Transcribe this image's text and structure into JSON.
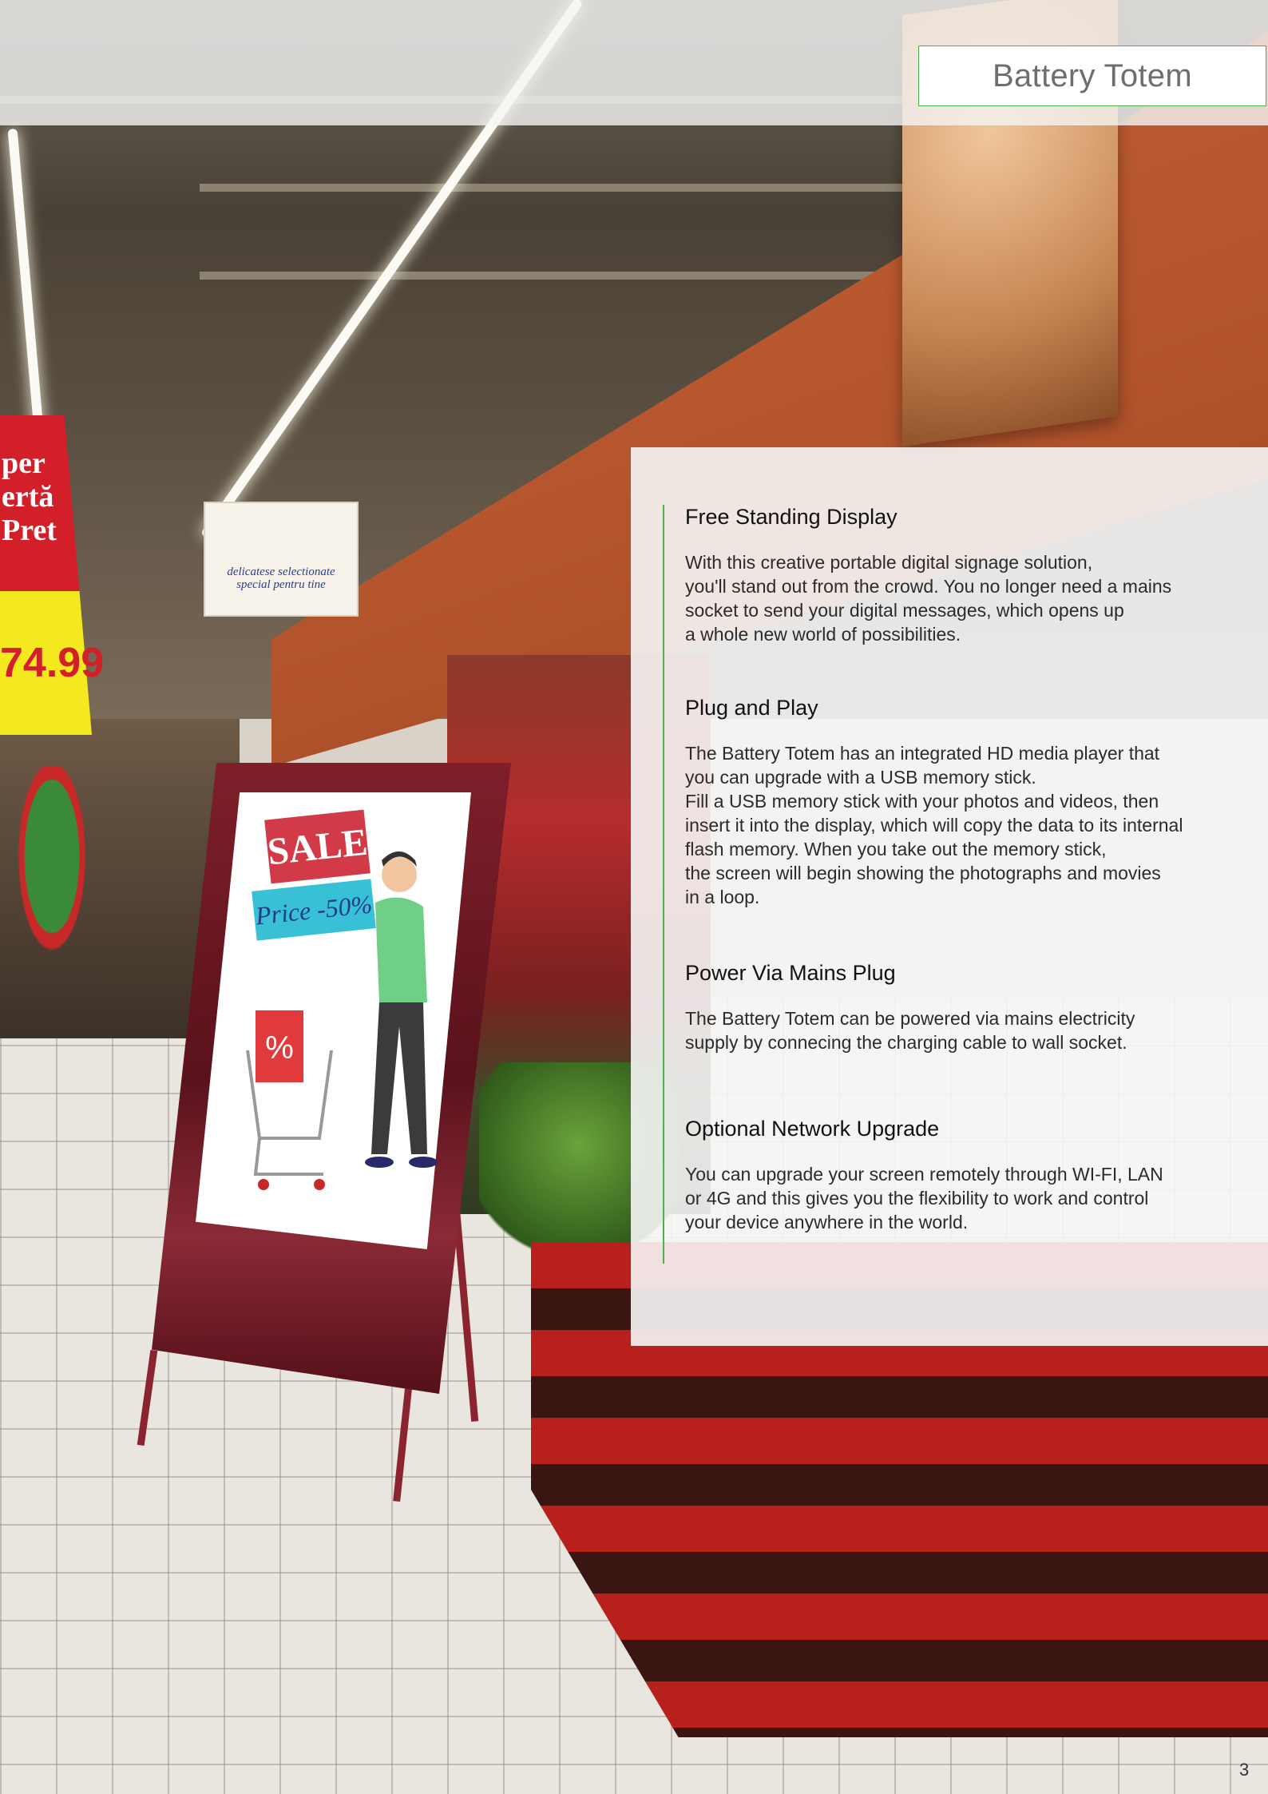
{
  "header": {
    "title": "Battery Totem",
    "accent_color": "#4caf50"
  },
  "sections": [
    {
      "heading": "Free Standing Display",
      "body": "With this creative portable digital signage solution,\nyou'll stand out from the crowd. You no longer need a mains\nsocket to send your digital messages, which opens up\na whole new world of possibilities."
    },
    {
      "heading": "Plug and Play",
      "body": "The Battery Totem has an integrated HD media player that\nyou can upgrade with a USB memory stick.\nFill a USB memory stick with your photos and videos, then\ninsert it into the display, which will copy the data to its internal\nflash memory. When you take out the memory stick,\nthe screen will begin showing the photographs and movies\nin a loop."
    },
    {
      "heading": "Power Via Mains Plug",
      "body": "The Battery Totem can be powered via mains electricity\nsupply by connecing the charging cable to wall socket."
    },
    {
      "heading": "Optional Network Upgrade",
      "body": "You can upgrade your screen remotely through WI-FI, LAN\nor 4G and this gives you the flexibility to work and control\nyour device anywhere in the world."
    }
  ],
  "photo": {
    "totem_screen": {
      "sale_text": "SALE",
      "price_text": "Price -50%"
    },
    "store_banner": {
      "text": "per\nertă\nPret",
      "price": "74.99"
    },
    "hanging_sign_text": "delicatese selectionate special pentru tine"
  },
  "footer": {
    "page_number": "3"
  }
}
